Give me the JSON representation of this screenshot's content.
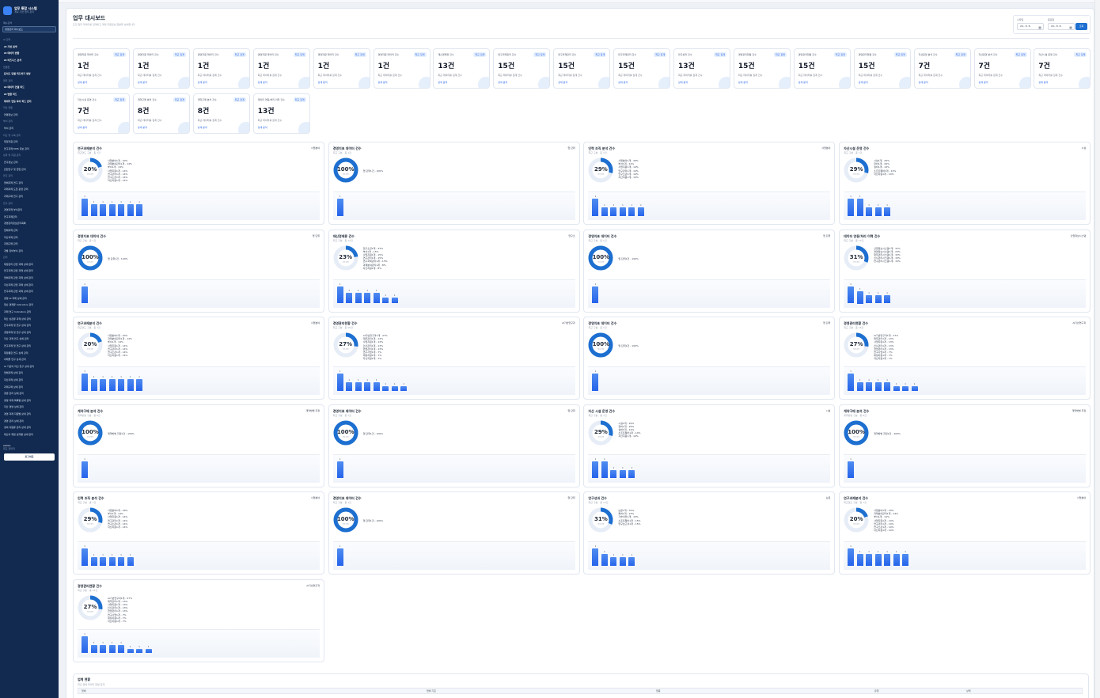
{
  "sidebar": {
    "brand_title": "업무 통합 시스템",
    "brand_sub": "계획 기반 업무 관리",
    "search_label": "메뉴검색",
    "search_value": "경영관리 대시보드",
    "items": [
      {
        "t": "AI 관리",
        "s": 1
      },
      {
        "t": "AI 기반 검색",
        "b": 1
      },
      {
        "t": "AI 데이터 변환",
        "b": 1
      },
      {
        "t": "AI 비즈니스 분석",
        "b": 1
      },
      {
        "t": "연결현",
        "s": 1
      },
      {
        "t": "문서도 연결 피드하기 생성",
        "b": 1
      },
      {
        "t": "업무 관리",
        "s": 1
      },
      {
        "t": "AI 데이터 연결 피드",
        "b": 1
      },
      {
        "t": "AI 변환 피드",
        "b": 1
      },
      {
        "t": "데이터 연동 부서 피드 관리",
        "b": 1
      },
      {
        "t": "자산 연동",
        "s": 1
      },
      {
        "t": "연결정보 관리"
      },
      {
        "t": "부서 관리",
        "s": 1
      },
      {
        "t": "부서 관리"
      },
      {
        "t": "자산 및 구축 관리",
        "s": 1
      },
      {
        "t": "재정지원 관리"
      },
      {
        "t": "연구과제 DMS 정보 관리"
      },
      {
        "t": "성과 및 지원 관리",
        "s": 1
      },
      {
        "t": "연구정보 관리"
      },
      {
        "t": "관련연구 및 협업 관리"
      },
      {
        "t": "연구 관리",
        "s": 1
      },
      {
        "t": "업체과제 연구 관리"
      },
      {
        "t": "과제과제 도입 운영 관리"
      },
      {
        "t": "과제구매 연구 관리"
      },
      {
        "t": "연구 관리",
        "s": 1
      },
      {
        "t": "경영과제 부서관리"
      },
      {
        "t": "연구과제관리"
      },
      {
        "t": "경영관리정보관리목록"
      },
      {
        "t": "업체과제 관리"
      },
      {
        "t": "자산과제 관리"
      },
      {
        "t": "과제구매 관리"
      },
      {
        "t": "개발 장비부서 관리"
      },
      {
        "t": "관리",
        "s": 1
      },
      {
        "t": "재정관리 관련 과제 상세 관리"
      },
      {
        "t": "연구과제 관련 과제 상세 관리"
      },
      {
        "t": "업체과제 관련 과제 상세 관리"
      },
      {
        "t": "자산과제 관련 과제 상세 관리"
      },
      {
        "t": "연구과제 관련 과제 상세 관리"
      },
      {
        "t": "경영 AI 과제 상세 관리"
      },
      {
        "t": "재산 경제류 Indicators 관리"
      },
      {
        "t": "과제 연구 Indicators 관리"
      },
      {
        "t": "재산 상관류 과제 상세 관리"
      },
      {
        "t": "연구과제 및 연구 상세 관리"
      },
      {
        "t": "경영과제 및 연구 상세 관리"
      },
      {
        "t": "자산 과제 연구 상세 관리"
      },
      {
        "t": "연구과제 및 연구 상세 관리"
      },
      {
        "t": "재정통합 연구 상세 관리"
      },
      {
        "t": "과제물 연구 상세 관리"
      },
      {
        "t": "AI 기반의 자산 연구 상세 관리"
      },
      {
        "t": "업체과제 상세 관리"
      },
      {
        "t": "자산과제 상세 관리"
      },
      {
        "t": "과제구매 상세 관리"
      },
      {
        "t": "경영 관리 상세 관리"
      },
      {
        "t": "경영 과제 목록별 상세 관리"
      },
      {
        "t": "자산 경영 상세 관리"
      },
      {
        "t": "경영 과제 자원별 상세 관리"
      },
      {
        "t": "경영 관리 상세 관리"
      },
      {
        "t": "경비 자원류 관리 상세 관리"
      },
      {
        "t": "재산의 재정 성과별 상세 관리"
      }
    ],
    "user_name": "admin",
    "user_role": "최고 관리자",
    "logout": "로그아웃"
  },
  "header": {
    "title": "업무 대시보드",
    "subtitle": "조건 업무 데이터를 집계하고 계획 지원정보 현황을 보여줍니다.",
    "start_label": "시작일",
    "end_label": "종료일",
    "start_value": "20-. 8. 8.",
    "end_value": "20-. 8. 8.",
    "query_button": "조회"
  },
  "tiles": [
    {
      "label": "경영지원 데이터 건수",
      "badge": "최근 집계",
      "value": "1건",
      "desc": "최근 데이터를 집계 건수",
      "link": "상세 분석"
    },
    {
      "label": "경영지원 데이터 건수",
      "badge": "최근 집계",
      "value": "1건",
      "desc": "최근 데이터를 집계 건수",
      "link": "상세 분석"
    },
    {
      "label": "경영지원 데이터 건수",
      "badge": "최근 집계",
      "value": "1건",
      "desc": "최근 데이터를 집계 건수",
      "link": "상세 분석"
    },
    {
      "label": "경영지원 데이터 건수",
      "badge": "최근 집계",
      "value": "1건",
      "desc": "최근 데이터를 집계 건수",
      "link": "상세 분석"
    },
    {
      "label": "경영지원 데이터 건수",
      "badge": "최근 집계",
      "value": "1건",
      "desc": "최근 데이터를 집계 건수",
      "link": "상세 분석"
    },
    {
      "label": "경영지원 데이터 건수",
      "badge": "최근 집계",
      "value": "1건",
      "desc": "최근 데이터를 집계 건수",
      "link": "상세 분석"
    },
    {
      "label": "재산경제류 건수",
      "badge": "최근 집계",
      "value": "13건",
      "desc": "최근 데이터를 집계 건수",
      "link": "상세 분석"
    },
    {
      "label": "연구과제관리 건수",
      "badge": "최근 집계",
      "value": "15건",
      "desc": "최근 데이터를 집계 건수",
      "link": "상세 분석"
    },
    {
      "label": "연구과제관리 건수",
      "badge": "최근 집계",
      "value": "15건",
      "desc": "최근 데이터를 집계 건수",
      "link": "상세 분석"
    },
    {
      "label": "연구과제관리 건수",
      "badge": "최근 집계",
      "value": "15건",
      "desc": "최근 데이터를 집계 건수",
      "link": "상세 분석"
    },
    {
      "label": "연구성과 건수",
      "badge": "최근 집계",
      "value": "13건",
      "desc": "최근 데이터를 집계 건수",
      "link": "상세 분석"
    },
    {
      "label": "경영관리현황 건수",
      "badge": "최근 집계",
      "value": "15건",
      "desc": "최근 데이터를 집계 건수",
      "link": "상세 분석"
    },
    {
      "label": "경영관리현황 건수",
      "badge": "최근 집계",
      "value": "15건",
      "desc": "최근 데이터를 집계 건수",
      "link": "상세 분석"
    },
    {
      "label": "경영관리현황 건수",
      "badge": "최근 집계",
      "value": "15건",
      "desc": "최근 데이터를 집계 건수",
      "link": "상세 분석"
    },
    {
      "label": "자산운영 분석 건수",
      "badge": "최근 집계",
      "value": "7건",
      "desc": "최근 데이터를 집계 건수",
      "link": "상세 분석"
    },
    {
      "label": "자산운영 분석 건수",
      "badge": "최근 집계",
      "value": "7건",
      "desc": "최근 데이터를 집계 건수",
      "link": "상세 분석"
    },
    {
      "label": "자산시설 운영 건수",
      "badge": "최근 집계",
      "value": "7건",
      "desc": "최근 데이터를 집계 건수",
      "link": "상세 분석"
    },
    {
      "label": "자산시설 운영 건수",
      "badge": "최근 집계",
      "value": "7건",
      "desc": "최근 데이터를 집계 건수",
      "link": "상세 분석"
    },
    {
      "label": "계약구매 분석 건수",
      "badge": "최근 집계",
      "value": "8건",
      "desc": "최근 데이터를 집계 건수",
      "link": "상세 분석"
    },
    {
      "label": "계약구매 분석 건수",
      "badge": "최근 집계",
      "value": "8건",
      "desc": "최근 데이터를 집계 건수",
      "link": "상세 분석"
    },
    {
      "label": "데이터 연동/처리 이력 건수",
      "badge": "최근 집계",
      "value": "13건",
      "desc": "최근 데이터를 집계 건수",
      "link": "상세 분석"
    }
  ],
  "panels": [
    {
      "title": "연구과제분석 건수",
      "period": "최근연도 구분 · 총 7건",
      "right": "사업분야",
      "pct": "20%",
      "frac": 0.2,
      "sub": "상위 분류",
      "legend": [
        "사업분야1개 - 20%",
        "과제분야관리1개 - 14%",
        "부서1개 - 14%",
        "사업지원1개 - 14%",
        "연구관리1개 - 14%",
        "연구소관1개 - 14%",
        "자산지원1개 - 14%"
      ],
      "bars": [
        7,
        5,
        5,
        5,
        5,
        5,
        5
      ]
    },
    {
      "title": "경영지표 데이터 건수",
      "period": "최근 구분 · 총 1건",
      "right": "업 단위",
      "pct": "100%",
      "frac": 1,
      "sub": "상위 분류",
      "legend": [
        "업 단위1건 - 100%"
      ],
      "bars": [
        7
      ]
    },
    {
      "title": "인력 조직 분석 건수",
      "period": "최근 구분 · 총 7건",
      "right": "사업분야",
      "pct": "29%",
      "frac": 0.29,
      "sub": "상위 분류",
      "legend": [
        "사업분야1개 - 29%",
        "부서1개 - 14%",
        "사업지원1개 - 14%",
        "연구관리1개 - 14%",
        "연구소관1개 - 14%",
        "자산지원1개 - 14%"
      ],
      "bars": [
        7,
        3.5,
        3.5,
        3.5,
        3.5,
        3.5
      ]
    },
    {
      "title": "자산시설 운영 건수",
      "period": "최근 구분 · 총 7건",
      "right": "시설",
      "pct": "29%",
      "frac": 0.29,
      "sub": "상위 분류",
      "legend": [
        "시설1개 - 29%",
        "장비1개 - 29%",
        "설비1개 - 14%",
        "소프트웨어1개 - 14%",
        "자산지원1개 - 14%"
      ],
      "bars": [
        7,
        7,
        3.5,
        3.5,
        3.5
      ]
    },
    {
      "title": "경영지표 데이터 건수",
      "period": "최근 구분 · 총 1건",
      "right": "업 단위",
      "pct": "100%",
      "frac": 1,
      "sub": "상위 분류",
      "legend": [
        "업 단위1건 - 100%"
      ],
      "bars": [
        7
      ]
    },
    {
      "title": "재산경제류 건수",
      "period": "최근 구분 · 총 13건",
      "right": "연구소",
      "pct": "23%",
      "frac": 0.23,
      "sub": "상위 분류",
      "legend": [
        "연구소관1개 - 23%",
        "부서1개 - 15%",
        "사업지원1개 - 15%",
        "연구관리1개 - 15%",
        "연구과제관리1개 - 15%",
        "과제분야관리1개 - 8%",
        "자산지원1개 - 8%"
      ],
      "bars": [
        7,
        4.5,
        4.5,
        4.5,
        4.5,
        2.3,
        2.3
      ]
    },
    {
      "title": "경영지표 데이터 건수",
      "period": "최근 구분 · 총 1건",
      "right": "업 단위",
      "pct": "100%",
      "frac": 1,
      "sub": "상위 분류",
      "legend": [
        "업 단위1건 - 100%"
      ],
      "bars": [
        7
      ]
    },
    {
      "title": "데이터 연동/처리 이력 건수",
      "period": "최근 구분 · 총 13건",
      "right": "산업정보시스템",
      "pct": "31%",
      "frac": 0.31,
      "sub": "상위 분류",
      "legend": [
        "산업정보시스템1개 - 31%",
        "경영정보시스템1개 - 23%",
        "재무관리시스템1개 - 15%",
        "인사관리시스템1개 - 15%",
        "연구관리시스템1개 - 15%"
      ],
      "bars": [
        7,
        5,
        3.5,
        3.5,
        3.5
      ]
    },
    {
      "title": "연구과제분석 건수",
      "period": "최근연도 구분 · 총 7건",
      "right": "사업분야",
      "pct": "20%",
      "frac": 0.2,
      "sub": "상위 분류",
      "legend": [
        "사업분야1개 - 20%",
        "과제분야관리1개 - 14%",
        "부서1개 - 14%",
        "사업지원1개 - 14%",
        "연구관리1개 - 14%",
        "연구소관1개 - 14%",
        "자산지원1개 - 14%"
      ],
      "bars": [
        7,
        5,
        5,
        5,
        5,
        5,
        5
      ]
    },
    {
      "title": "경영관리현황 건수",
      "period": "최근 구분 · 총 15건",
      "right": "AI기반연구과",
      "pct": "27%",
      "frac": 0.27,
      "sub": "상위 분류",
      "legend": [
        "AI기반연구과1개 - 27%",
        "재무관리1개 - 13%",
        "사업지원1개 - 13%",
        "인사관리1개 - 13%",
        "협업관리1개 - 13%",
        "연구사업1개 - 7%",
        "재정지원1개 - 7%",
        "자산지원1개 - 7%"
      ],
      "bars": [
        7,
        3.5,
        3.5,
        3.5,
        3.5,
        1.8,
        1.8,
        1.8
      ]
    },
    {
      "title": "경영지표 데이터 건수",
      "period": "최근 구분 · 총 1건",
      "right": "업 단위",
      "pct": "100%",
      "frac": 1,
      "sub": "상위 분류",
      "legend": [
        "업 단위1건 - 100%"
      ],
      "bars": [
        7
      ]
    },
    {
      "title": "경영관리현황 건수",
      "period": "최근 구분 · 총 15건",
      "right": "AI기반연구과",
      "pct": "27%",
      "frac": 0.27,
      "sub": "상위 분류",
      "legend": [
        "AI기반연구과1개 - 27%",
        "재무관리1개 - 13%",
        "사업지원1개 - 13%",
        "인사관리1개 - 13%",
        "협업관리1개 - 13%",
        "연구사업1개 - 7%",
        "재정지원1개 - 7%",
        "자산지원1개 - 7%"
      ],
      "bars": [
        7,
        3.5,
        3.5,
        3.5,
        3.5,
        1.8,
        1.8,
        1.8
      ]
    },
    {
      "title": "계약구매 분석 건수",
      "period": "계약방법 구분 · 총 8건",
      "right": "계약방법 지정",
      "pct": "100%",
      "frac": 1,
      "sub": "상위 분류",
      "legend": [
        "계약방법 지정1건 - 100%"
      ],
      "bars": [
        7
      ]
    },
    {
      "title": "경영지표 데이터 건수",
      "period": "최근 구분 · 총 1건",
      "right": "업 단위",
      "pct": "100%",
      "frac": 1,
      "sub": "상위 분류",
      "legend": [
        "업 단위1건 - 100%"
      ],
      "bars": [
        7
      ]
    },
    {
      "title": "자산 시설 운영 건수",
      "period": "최근 구분 · 총 7건",
      "right": "시설",
      "pct": "29%",
      "frac": 0.29,
      "sub": "상위 분류",
      "legend": [
        "시설1개 - 29%",
        "장비1개 - 29%",
        "설비1개 - 14%",
        "소프트웨어1개 - 14%",
        "자산지원1개 - 14%"
      ],
      "bars": [
        7,
        7,
        3.5,
        3.5,
        3.5
      ]
    },
    {
      "title": "계약구매 분석 건수",
      "period": "계약방법 구분 · 총 8건",
      "right": "계약방법 지정",
      "pct": "100%",
      "frac": 1,
      "sub": "상위 분류",
      "legend": [
        "계약방법 지정1건 - 100%"
      ],
      "bars": [
        7
      ]
    },
    {
      "title": "인력 조직 분석 건수",
      "period": "최근 구분 · 총 7건",
      "right": "사업분야",
      "pct": "29%",
      "frac": 0.29,
      "sub": "상위 분류",
      "legend": [
        "사업분야1개 - 29%",
        "부서1개 - 14%",
        "사업지원1개 - 14%",
        "연구관리1개 - 14%",
        "연구소관1개 - 14%",
        "자산지원1개 - 14%"
      ],
      "bars": [
        7,
        3.5,
        3.5,
        3.5,
        3.5,
        3.5
      ]
    },
    {
      "title": "경영지표 데이터 건수",
      "period": "최근 구분 · 총 1건",
      "right": "업 단위",
      "pct": "100%",
      "frac": 1,
      "sub": "상위 분류",
      "legend": [
        "업 단위1건 - 100%"
      ],
      "bars": [
        7
      ]
    },
    {
      "title": "연구성과 건수",
      "period": "최근 구분 · 총 13건",
      "right": "논문",
      "pct": "31%",
      "frac": 0.31,
      "sub": "상위 분류",
      "legend": [
        "논문1개 - 31%",
        "특허1개 - 23%",
        "기술이전1개 - 15%",
        "소프트웨어1개 - 15%",
        "연구보고서1개 - 15%"
      ],
      "bars": [
        7,
        5,
        3.5,
        3.5,
        3.5
      ]
    },
    {
      "title": "연구과제분석 건수",
      "period": "최근연도 구분 · 총 7건",
      "right": "사업분야",
      "pct": "20%",
      "frac": 0.2,
      "sub": "상위 분류",
      "legend": [
        "사업분야1개 - 20%",
        "과제분야관리1개 - 14%",
        "부서1개 - 14%",
        "사업지원1개 - 14%",
        "연구관리1개 - 14%",
        "연구소관1개 - 14%",
        "자산지원1개 - 14%"
      ],
      "bars": [
        7,
        5,
        5,
        5,
        5,
        5,
        5
      ]
    },
    {
      "title": "경영관리현황 건수",
      "period": "최근 구분 · 총 15건",
      "right": "AI기반연구과",
      "pct": "27%",
      "frac": 0.27,
      "sub": "상위 분류",
      "legend": [
        "AI기반연구과1개 - 27%",
        "재무관리1개 - 13%",
        "사업지원1개 - 13%",
        "인사관리1개 - 13%",
        "협업관리1개 - 13%",
        "연구사업1개 - 7%",
        "재정지원1개 - 7%",
        "자산지원1개 - 7%"
      ],
      "bars": [
        7,
        3.5,
        3.5,
        3.5,
        3.5,
        1.8,
        1.8,
        1.8
      ]
    }
  ],
  "table": {
    "title": "업체 현황",
    "subtitle": "최근 업체 데이터 현황 집계",
    "columns": [
      "업체",
      "업체 기준",
      "업종",
      "유형",
      "상태"
    ]
  },
  "colors": {
    "sidebar": "#122a4f",
    "accent": "#2563eb",
    "donut": "#1d6fd0"
  }
}
